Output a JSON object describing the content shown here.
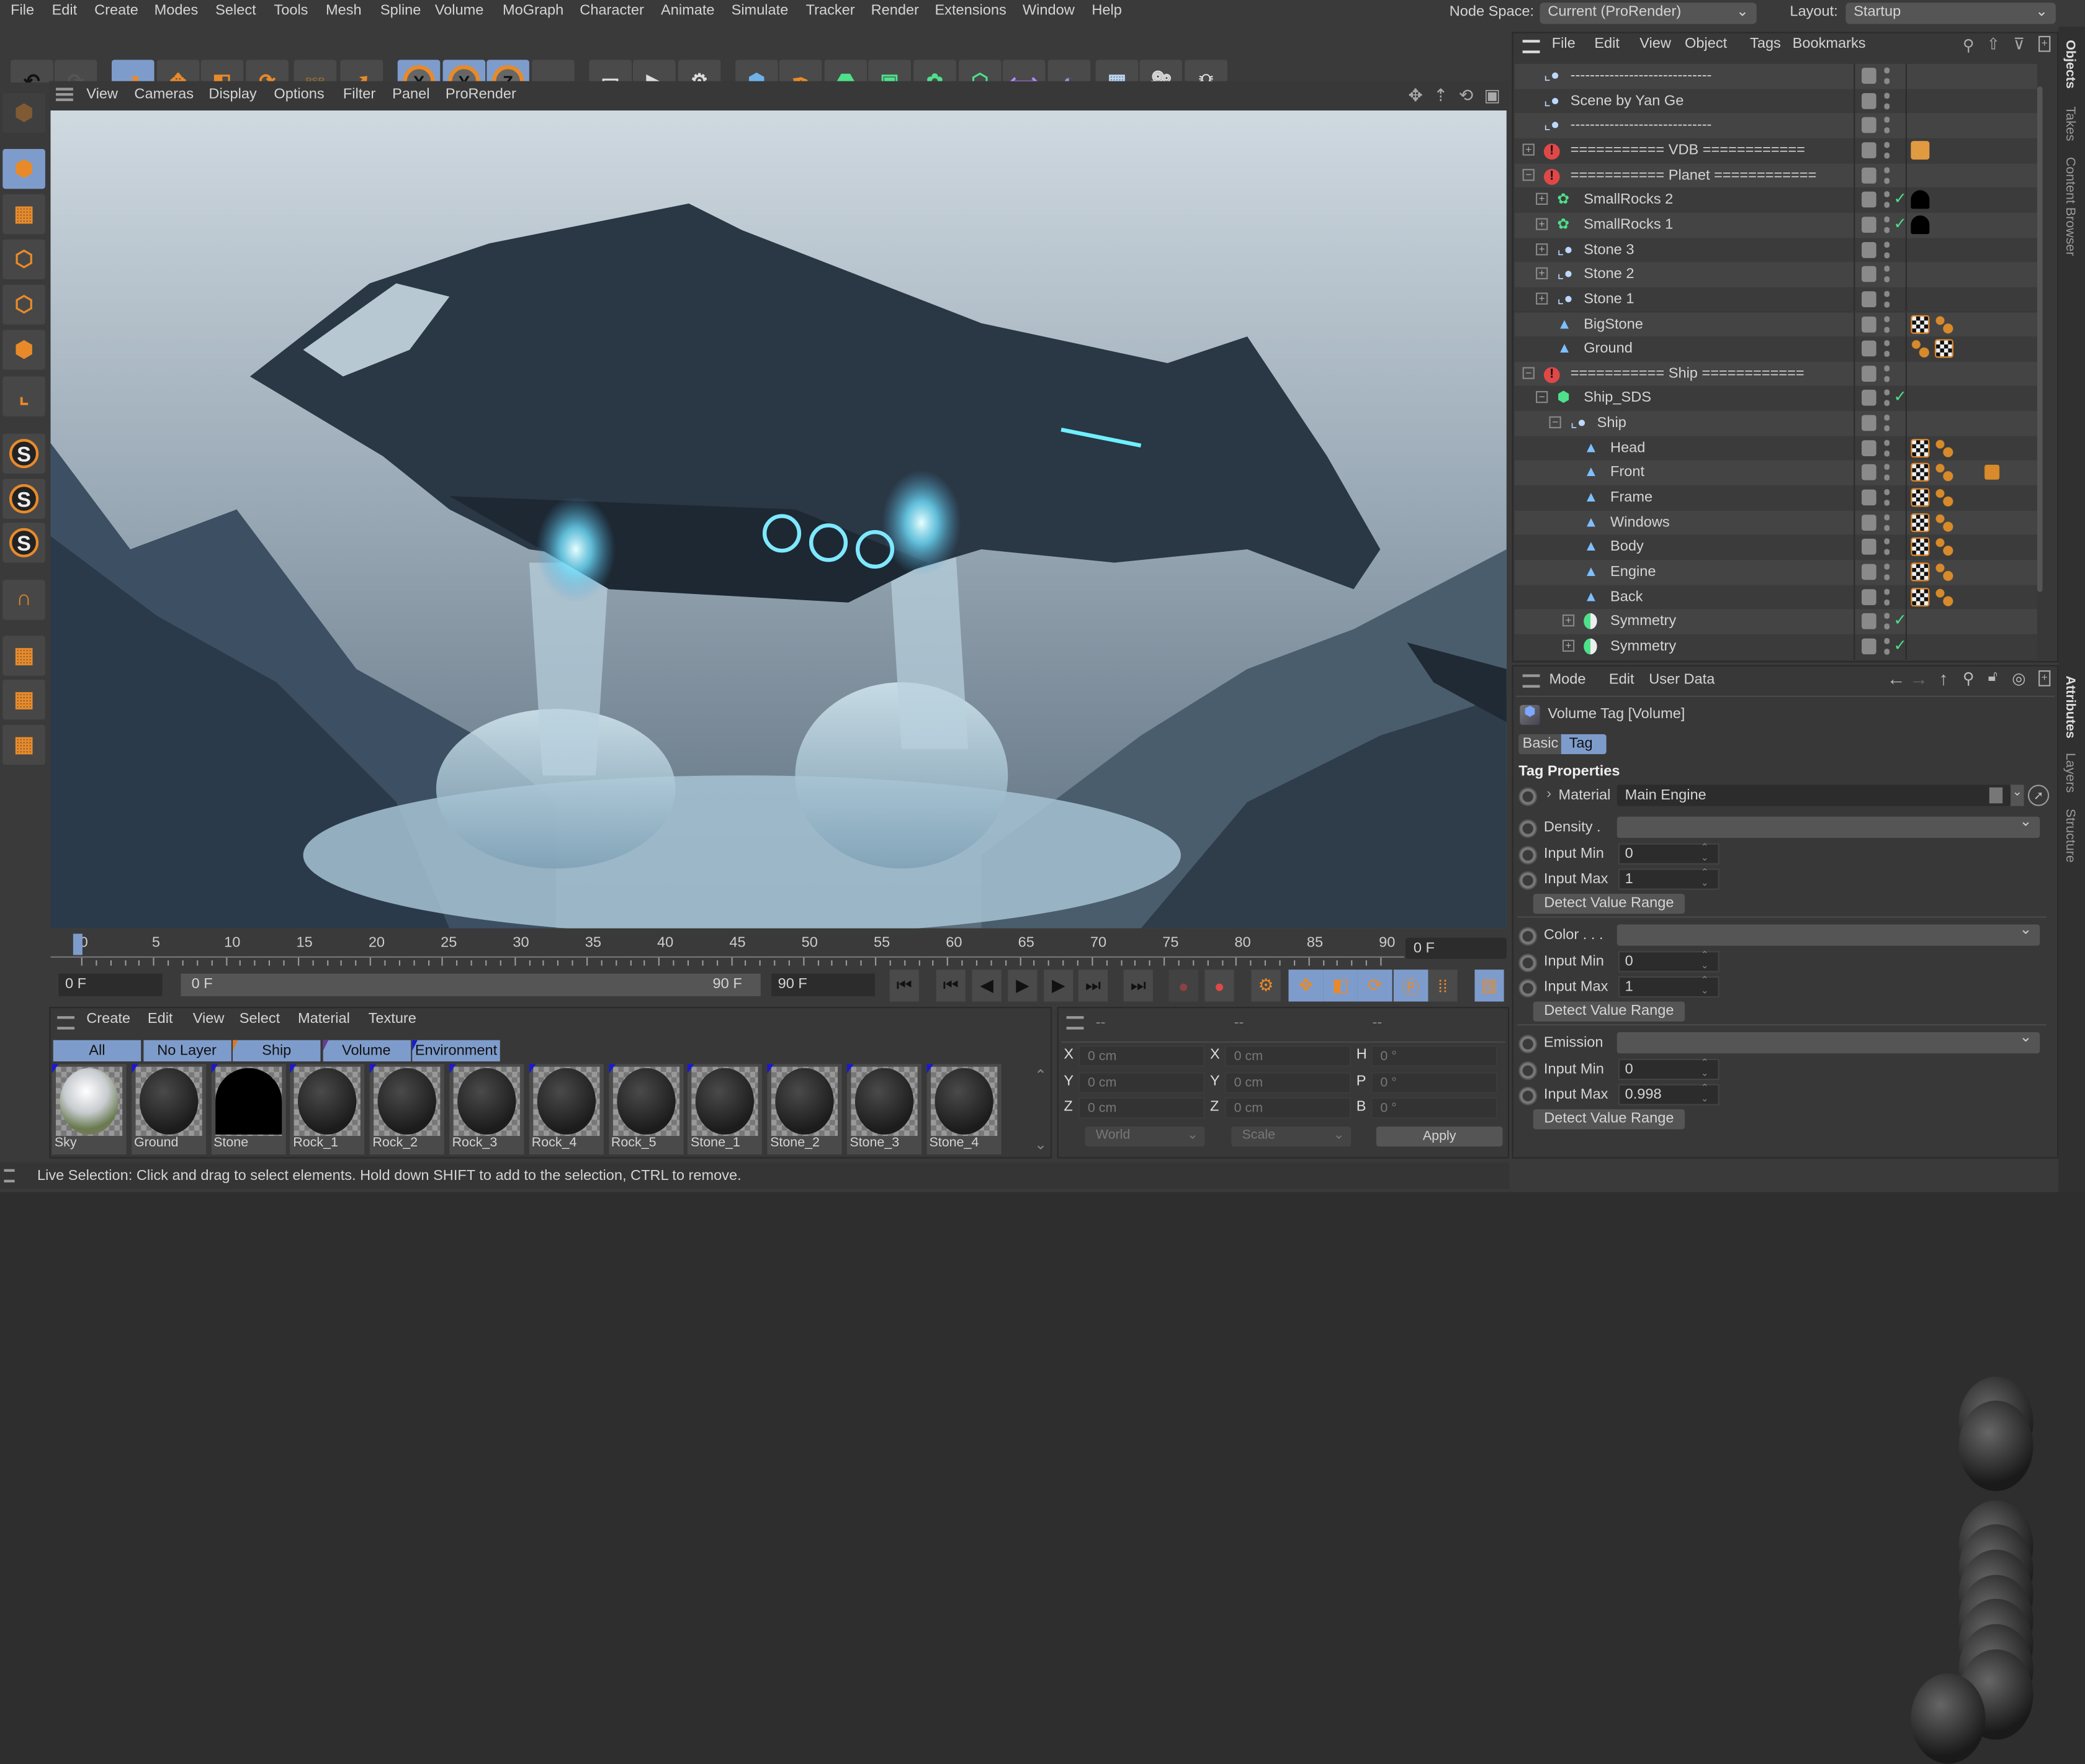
{
  "menubar": {
    "items": [
      "File",
      "Edit",
      "Create",
      "Modes",
      "Select",
      "Tools",
      "Mesh",
      "Spline",
      "Volume",
      "MoGraph",
      "Character",
      "Animate",
      "Simulate",
      "Tracker",
      "Render",
      "Extensions",
      "Window",
      "Help"
    ],
    "node_space_label": "Node Space:",
    "node_space_value": "Current (ProRender)",
    "layout_label": "Layout:",
    "layout_value": "Startup"
  },
  "toolbar": {
    "buttons": [
      {
        "icon": "undo-icon",
        "active": false
      },
      {
        "icon": "redo-icon",
        "active": false
      },
      {
        "icon": "live-selection-icon",
        "active": true
      },
      {
        "icon": "move-icon",
        "active": false
      },
      {
        "icon": "scale-icon",
        "active": false
      },
      {
        "icon": "rotate-icon",
        "active": false
      },
      {
        "icon": "psr-icon",
        "active": false,
        "label": "PSR"
      },
      {
        "icon": "last-tool-icon",
        "active": false
      },
      {
        "icon": "x-axis-icon",
        "active": true,
        "label": "X"
      },
      {
        "icon": "y-axis-icon",
        "active": true,
        "label": "Y"
      },
      {
        "icon": "z-axis-icon",
        "active": true,
        "label": "Z"
      },
      {
        "icon": "coordinate-system-icon",
        "active": false
      },
      {
        "icon": "render-view-icon",
        "active": false
      },
      {
        "icon": "render-to-picture-viewer-icon",
        "active": false
      },
      {
        "icon": "render-settings-icon",
        "active": false
      },
      {
        "icon": "cube-icon",
        "active": false
      },
      {
        "icon": "pen-icon",
        "active": false
      },
      {
        "icon": "subdivision-surface-icon",
        "active": false
      },
      {
        "icon": "extrude-icon",
        "active": false
      },
      {
        "icon": "cloner-icon",
        "active": false
      },
      {
        "icon": "mograph-icon",
        "active": false
      },
      {
        "icon": "deformer-icon",
        "active": false
      },
      {
        "icon": "field-icon",
        "active": false
      },
      {
        "icon": "floor-icon",
        "active": false
      },
      {
        "icon": "camera-icon",
        "active": false
      },
      {
        "icon": "light-icon",
        "active": false
      }
    ]
  },
  "left_palette": [
    "make-editable-icon",
    "model-mode-icon",
    "texture-mode-icon",
    "points-mode-icon",
    "edges-mode-icon",
    "polygons-mode-icon",
    "axis-icon",
    "solo-icon",
    "solo-hierarchy-icon",
    "solo-selection-icon",
    "snap-magnet-icon",
    "workplane-icon",
    "grid-snap-icon",
    "locked-workplane-icon"
  ],
  "viewport": {
    "menu": [
      "View",
      "Cameras",
      "Display",
      "Options",
      "Filter",
      "Panel",
      "ProRender"
    ],
    "nav_icons": [
      "pan-icon",
      "dolly-icon",
      "orbit-icon",
      "toggle-view-icon"
    ]
  },
  "timeline": {
    "start": 0,
    "end": 90,
    "step": 5,
    "current_frame": 0,
    "current_label": "0 F",
    "min_field": "0 F",
    "range_start": "0 F",
    "range_end": "90 F",
    "max_field": "90 F"
  },
  "transport": [
    "goto-start-icon",
    "goto-prev-key-icon",
    "step-back-icon",
    "play-icon",
    "step-forward-icon",
    "goto-next-key-icon",
    "goto-end-icon",
    "record-key-icon",
    "autokey-icon",
    "keyframe-settings-icon",
    "key-position-icon",
    "key-scale-icon",
    "key-rotation-icon",
    "key-parameter-icon",
    "key-pla-icon",
    "timeline-icon"
  ],
  "materials": {
    "menu": [
      "Create",
      "Edit",
      "View",
      "Select",
      "Material",
      "Texture"
    ],
    "layers": [
      {
        "label": "All",
        "flag": ""
      },
      {
        "label": "No Layer",
        "flag": ""
      },
      {
        "label": "Ship",
        "flag": "#d9782a"
      },
      {
        "label": "Volume",
        "flag": "#6a3a9a"
      },
      {
        "label": "Environment",
        "flag": "#1a1acc"
      }
    ],
    "items": [
      "Sky",
      "Ground",
      "Stone",
      "Rock_1",
      "Rock_2",
      "Rock_3",
      "Rock_4",
      "Rock_5",
      "Stone_1",
      "Stone_2",
      "Stone_3",
      "Stone_4"
    ]
  },
  "coordinates": {
    "headers": [
      "--",
      "--",
      "--"
    ],
    "rows": [
      {
        "l1": "X",
        "v1": "0 cm",
        "l2": "X",
        "v2": "0 cm",
        "l3": "H",
        "v3": "0 °"
      },
      {
        "l1": "Y",
        "v1": "0 cm",
        "l2": "Y",
        "v2": "0 cm",
        "l3": "P",
        "v3": "0 °"
      },
      {
        "l1": "Z",
        "v1": "0 cm",
        "l2": "Z",
        "v2": "0 cm",
        "l3": "B",
        "v3": "0 °"
      }
    ],
    "mode1": "World",
    "mode2": "Scale",
    "apply": "Apply"
  },
  "status": "Live Selection: Click and drag to select elements. Hold down SHIFT to add to the selection, CTRL to remove.",
  "objects": {
    "menu": [
      "File",
      "Edit",
      "View",
      "Object",
      "Tags",
      "Bookmarks"
    ],
    "rows": [
      {
        "name": "-----------------------------",
        "level": 0,
        "type": "null",
        "exp": "",
        "check": false,
        "tags": []
      },
      {
        "name": "Scene by Yan Ge",
        "level": 0,
        "type": "null",
        "exp": "",
        "check": false,
        "tags": []
      },
      {
        "name": "-----------------------------",
        "level": 0,
        "type": "null",
        "exp": "",
        "check": false,
        "tags": []
      },
      {
        "name": "=========== VDB ============",
        "level": 0,
        "type": "warn",
        "exp": "+",
        "check": false,
        "tags": [
          "note"
        ]
      },
      {
        "name": "=========== Planet ============",
        "level": 0,
        "type": "warn",
        "exp": "-",
        "check": false,
        "tags": []
      },
      {
        "name": "SmallRocks 2",
        "level": 1,
        "type": "cloner",
        "exp": "+",
        "check": true,
        "tags": [
          "black"
        ]
      },
      {
        "name": "SmallRocks 1",
        "level": 1,
        "type": "cloner",
        "exp": "+",
        "check": true,
        "tags": [
          "black"
        ]
      },
      {
        "name": "Stone 3",
        "level": 1,
        "type": "null",
        "exp": "+",
        "check": false,
        "tags": []
      },
      {
        "name": "Stone 2",
        "level": 1,
        "type": "null",
        "exp": "+",
        "check": false,
        "tags": []
      },
      {
        "name": "Stone 1",
        "level": 1,
        "type": "null",
        "exp": "+",
        "check": false,
        "tags": []
      },
      {
        "name": "BigStone",
        "level": 1,
        "type": "poly",
        "exp": "",
        "check": false,
        "tags": [
          "uvw",
          "phong",
          "mat"
        ]
      },
      {
        "name": "Ground",
        "level": 1,
        "type": "poly",
        "exp": "",
        "check": false,
        "tags": [
          "phong",
          "uvw",
          "mat"
        ]
      },
      {
        "name": "=========== Ship ============",
        "level": 0,
        "type": "warn",
        "exp": "-",
        "check": false,
        "tags": []
      },
      {
        "name": "Ship_SDS",
        "level": 1,
        "type": "sds",
        "exp": "-",
        "check": true,
        "tags": []
      },
      {
        "name": "Ship",
        "level": 2,
        "type": "null",
        "exp": "-",
        "check": false,
        "tags": []
      },
      {
        "name": "Head",
        "level": 3,
        "type": "poly",
        "exp": "",
        "check": false,
        "tags": [
          "uvw",
          "phong",
          "mat"
        ]
      },
      {
        "name": "Front",
        "level": 3,
        "type": "poly",
        "exp": "",
        "check": false,
        "tags": [
          "uvw",
          "phong",
          "mat",
          "vol"
        ]
      },
      {
        "name": "Frame",
        "level": 3,
        "type": "poly",
        "exp": "",
        "check": false,
        "tags": [
          "uvw",
          "phong",
          "mat"
        ]
      },
      {
        "name": "Windows",
        "level": 3,
        "type": "poly",
        "exp": "",
        "check": false,
        "tags": [
          "uvw",
          "phong",
          "mat"
        ]
      },
      {
        "name": "Body",
        "level": 3,
        "type": "poly",
        "exp": "",
        "check": false,
        "tags": [
          "uvw",
          "phong",
          "mat"
        ]
      },
      {
        "name": "Engine",
        "level": 3,
        "type": "poly",
        "exp": "",
        "check": false,
        "tags": [
          "uvw",
          "phong",
          "mat"
        ]
      },
      {
        "name": "Back",
        "level": 3,
        "type": "poly",
        "exp": "",
        "check": false,
        "tags": [
          "uvw",
          "phong",
          "mat"
        ]
      },
      {
        "name": "Symmetry",
        "level": 3,
        "type": "sym",
        "exp": "+",
        "check": true,
        "tags": [
          "mat"
        ]
      },
      {
        "name": "Symmetry",
        "level": 3,
        "type": "sym",
        "exp": "+",
        "check": true,
        "tags": []
      }
    ]
  },
  "side_tabs_top": [
    "Objects",
    "Takes",
    "Content Browser"
  ],
  "side_tabs_bottom": [
    "Attributes",
    "Layers",
    "Structure"
  ],
  "attributes": {
    "menu": [
      "Mode",
      "Edit",
      "User Data"
    ],
    "title": "Volume Tag [Volume]",
    "tabs": [
      "Basic",
      "Tag"
    ],
    "active_tab": "Tag",
    "section": "Tag Properties",
    "material_label": "Material",
    "material_value": "Main Engine",
    "groups": [
      {
        "label": "Density .",
        "min_label": "Input Min",
        "min": "0",
        "max_label": "Input Max",
        "max": "1",
        "button": "Detect Value Range"
      },
      {
        "label": "Color . . .",
        "min_label": "Input Min",
        "min": "0",
        "max_label": "Input Max",
        "max": "1",
        "button": "Detect Value Range"
      },
      {
        "label": "Emission",
        "min_label": "Input Min",
        "min": "0",
        "max_label": "Input Max",
        "max": "0.998",
        "button": "Detect Value Range"
      }
    ]
  },
  "colors": {
    "accent": "#7e9ccb",
    "orange": "#e88a2a",
    "check": "#4ee08a",
    "warn": "#e04848"
  }
}
